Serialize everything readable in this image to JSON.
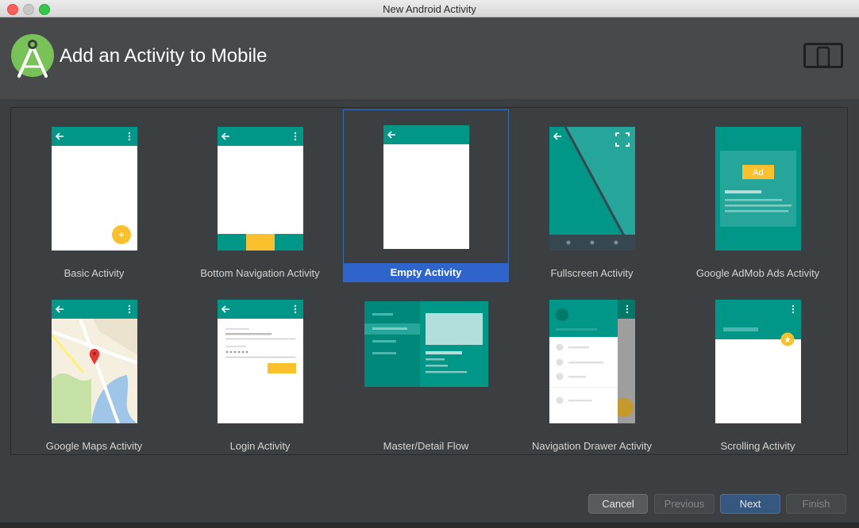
{
  "window": {
    "title": "New Android Activity"
  },
  "header": {
    "title": "Add an Activity to Mobile"
  },
  "colors": {
    "teal": "#009688",
    "teal_light": "#26a69a",
    "amber": "#fbc02d",
    "selection": "#2f65ca",
    "background": "#3c3f41"
  },
  "gallery": {
    "templates": [
      {
        "label": "Basic Activity",
        "selected": false
      },
      {
        "label": "Bottom Navigation Activity",
        "selected": false
      },
      {
        "label": "Empty Activity",
        "selected": true
      },
      {
        "label": "Fullscreen Activity",
        "selected": false
      },
      {
        "label": "Google AdMob Ads Activity",
        "selected": false,
        "badge": "Ad"
      },
      {
        "label": "Google Maps Activity",
        "selected": false
      },
      {
        "label": "Login Activity",
        "selected": false
      },
      {
        "label": "Master/Detail Flow",
        "selected": false
      },
      {
        "label": "Navigation Drawer Activity",
        "selected": false
      },
      {
        "label": "Scrolling Activity",
        "selected": false
      }
    ]
  },
  "footer": {
    "cancel_label": "Cancel",
    "previous_label": "Previous",
    "next_label": "Next",
    "finish_label": "Finish"
  }
}
